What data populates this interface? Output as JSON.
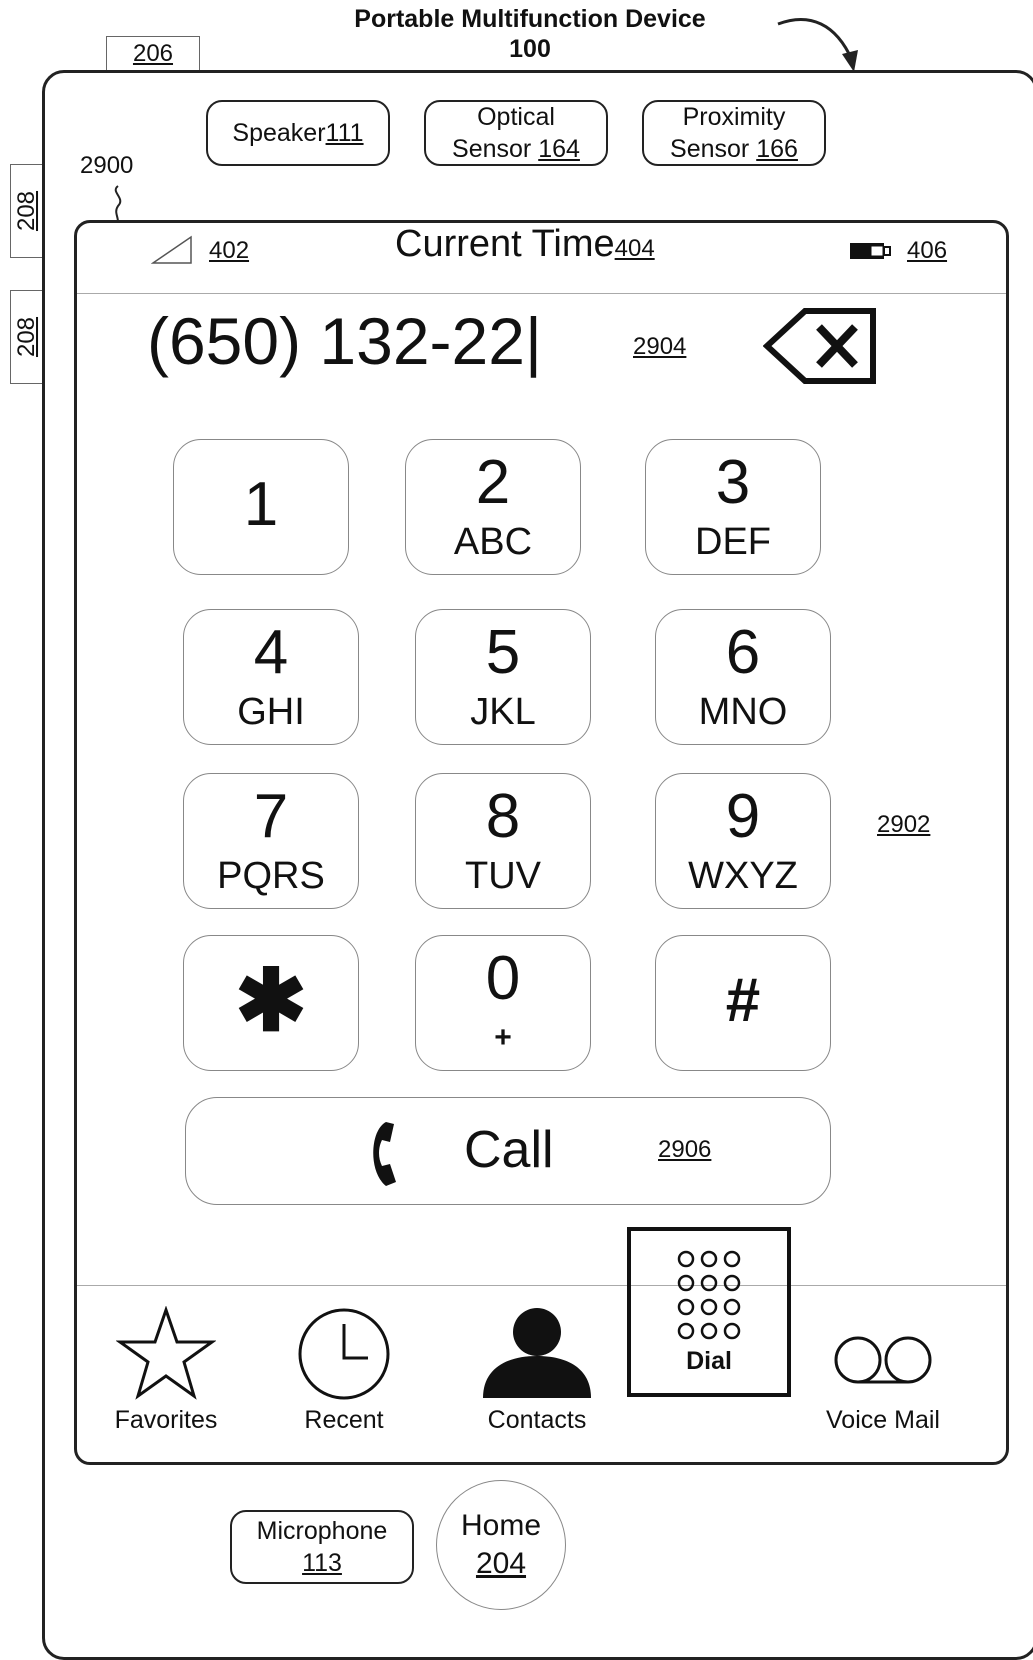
{
  "figure": {
    "title_line1": "Portable Multifunction Device",
    "title_line2": "100",
    "ref_206": "206",
    "ref_208a": "208",
    "ref_208b": "208",
    "ref_2900": "2900",
    "ref_2902": "2902"
  },
  "hardware": {
    "speaker": {
      "label": "Speaker ",
      "ref": "111"
    },
    "optical": {
      "line1": "Optical",
      "line2": "Sensor ",
      "ref": "164"
    },
    "proximity": {
      "line1": "Proximity",
      "line2": "Sensor ",
      "ref": "166"
    },
    "microphone": {
      "line1": "Microphone",
      "ref": "113"
    },
    "home": {
      "line1": "Home",
      "ref": "204"
    }
  },
  "status_bar": {
    "signal_ref": "402",
    "time_label": "Current Time ",
    "time_ref": "404",
    "battery_ref": "406"
  },
  "dialer": {
    "number": "(650) 132-22|",
    "number_ref": "2904",
    "keys": [
      {
        "digit": "1",
        "letters": ""
      },
      {
        "digit": "2",
        "letters": "ABC"
      },
      {
        "digit": "3",
        "letters": "DEF"
      },
      {
        "digit": "4",
        "letters": "GHI"
      },
      {
        "digit": "5",
        "letters": "JKL"
      },
      {
        "digit": "6",
        "letters": "MNO"
      },
      {
        "digit": "7",
        "letters": "PQRS"
      },
      {
        "digit": "8",
        "letters": "TUV"
      },
      {
        "digit": "9",
        "letters": "WXYZ"
      },
      {
        "digit": "✱",
        "letters": ""
      },
      {
        "digit": "0",
        "letters": "+"
      },
      {
        "digit": "#",
        "letters": ""
      }
    ],
    "call_label": "Call",
    "call_ref": "2906"
  },
  "tabs": [
    {
      "label": "Favorites",
      "icon": "star-icon",
      "active": false
    },
    {
      "label": "Recent",
      "icon": "clock-icon",
      "active": false
    },
    {
      "label": "Contacts",
      "icon": "person-icon",
      "active": false
    },
    {
      "label": "Dial",
      "icon": "keypad-icon",
      "active": true
    },
    {
      "label": "Voice Mail",
      "icon": "voicemail-icon",
      "active": false
    }
  ]
}
